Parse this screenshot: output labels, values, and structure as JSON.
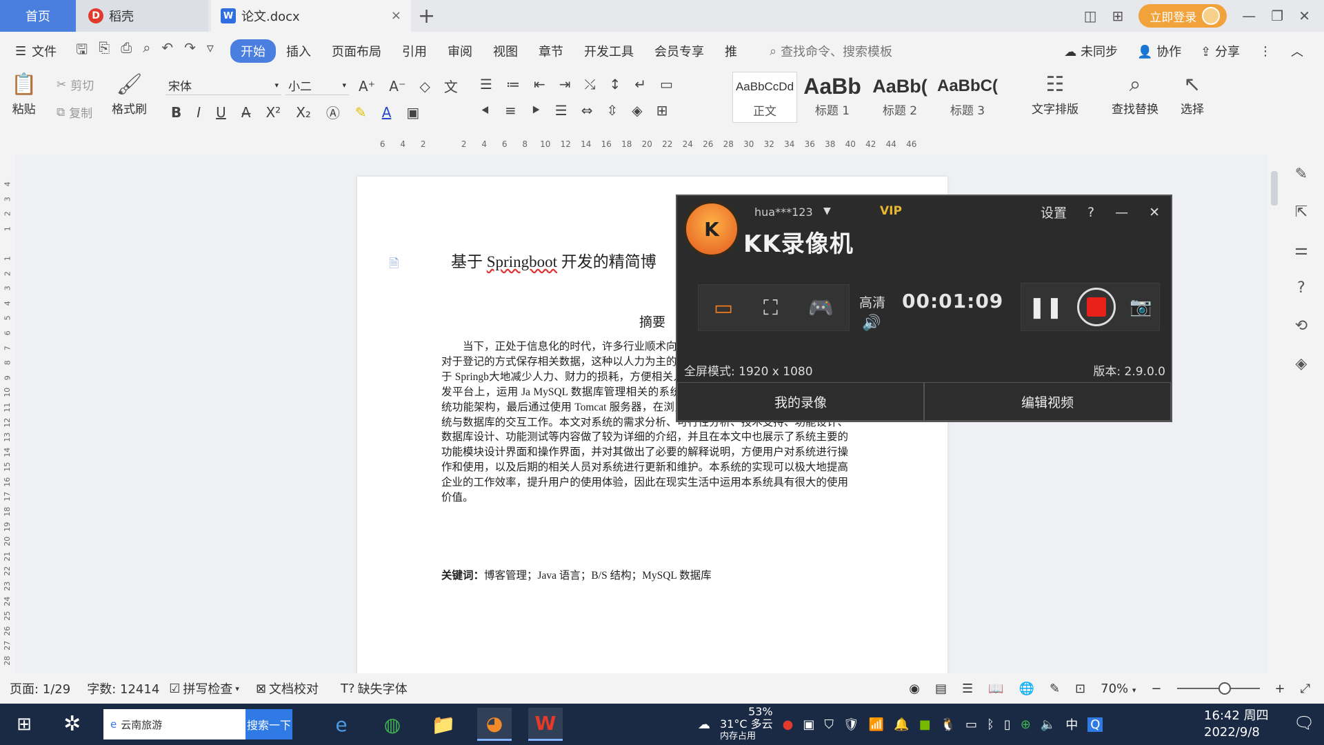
{
  "titlebar": {
    "tabs": [
      {
        "label": "首页"
      },
      {
        "label": "稻壳"
      },
      {
        "label": "论文.docx"
      }
    ],
    "login": "立即登录"
  },
  "menu": {
    "file": "文件",
    "tabs": [
      "开始",
      "插入",
      "页面布局",
      "引用",
      "审阅",
      "视图",
      "章节",
      "开发工具",
      "会员专享",
      "推"
    ],
    "search_placeholder": "查找命令、搜索模板",
    "sync": "未同步",
    "collab": "协作",
    "share": "分享"
  },
  "ribbon": {
    "paste": "粘贴",
    "cut": "剪切",
    "copy": "复制",
    "format_painter": "格式刷",
    "font_name": "宋体",
    "font_size": "小二",
    "styles": [
      {
        "sample": "AaBbCcDd",
        "name": "正文"
      },
      {
        "sample": "AaBb",
        "name": "标题 1"
      },
      {
        "sample": "AaBb(",
        "name": "标题 2"
      },
      {
        "sample": "AaBbC(",
        "name": "标题 3"
      }
    ],
    "text_layout": "文字排版",
    "find_replace": "查找替换",
    "select": "选择"
  },
  "ruler": {
    "marks": [
      "6",
      "4",
      "2",
      "",
      "2",
      "4",
      "6",
      "8",
      "10",
      "12",
      "14",
      "16",
      "18",
      "20",
      "22",
      "24",
      "26",
      "28",
      "30",
      "32",
      "34",
      "36",
      "38",
      "40",
      "42",
      "44",
      "46"
    ],
    "vmarks": [
      "4",
      "3",
      "2",
      "1",
      "",
      "1",
      "2",
      "3",
      "4",
      "5",
      "6",
      "7",
      "8",
      "9",
      "10",
      "11",
      "12",
      "13",
      "14",
      "15",
      "16",
      "17",
      "18",
      "19",
      "20",
      "21",
      "22",
      "23",
      "24",
      "25",
      "26",
      "27",
      "28"
    ]
  },
  "document": {
    "title_pre": "基于 ",
    "title_spell": "Springboot",
    "title_post": " 开发的精简博",
    "heading": "摘要",
    "abstract": "当下，正处于信息化的时代，许多行业顺术向数字化、信息化建设迈进。以前企业对于登记的方式保存相关数据，这种以人力为主的主流的程序开发技术，设计了一款基于 Springb大地减少人力、财力的损耗，方便相关人员及时用 B/S 开发模式，在 idea 开发平台上，运用 Ja MySQL 数据库管理相关的系统数据信息，SSM 框架设计和开发系统功能架构，最后通过使用 Tomcat 服务器，在浏览器中发布设计的系统，并且完成系统与数据库的交互工作。本文对系统的需求分析、可行性分析、技术支持、功能设计、数据库设计、功能测试等内容做了较为详细的介绍，并且在本文中也展示了系统主要的功能模块设计界面和操作界面，并对其做出了必要的解释说明，方便用户对系统进行操作和使用，以及后期的相关人员对系统进行更新和维护。本系统的实现可以极大地提高企业的工作效率，提升用户的使用体验，因此在现实生活中运用本系统具有很大的使用价值。",
    "keywords_label": "关键词：",
    "keywords": "博客管理；Java 语言；B/S 结构；MySQL 数据库"
  },
  "kk": {
    "user": "hua***123",
    "vip": "VIP",
    "title": "KK录像机",
    "settings": "设置",
    "help": "?",
    "quality": "高清",
    "timer": "00:01:09",
    "mode_text": "全屏模式: 1920 x 1080",
    "version": "版本: 2.9.0.0",
    "my_recordings": "我的录像",
    "edit_video": "编辑视频"
  },
  "status": {
    "page": "页面: 1/29",
    "words": "字数: 12414",
    "spellcheck": "拼写检查",
    "proof": "文档校对",
    "missing_font": "缺失字体",
    "zoom": "70%"
  },
  "taskbar": {
    "search_text": "云南旅游",
    "search_btn": "搜索一下",
    "weather_temp": "31°C 多云",
    "mem_pct": "53%",
    "mem_label": "内存占用",
    "ime": "中",
    "time": "16:42 周四",
    "date": "2022/9/8"
  },
  "colors": {
    "accent": "#4a7fe0",
    "kk_bg": "#2b2b2b",
    "record_red": "#e8211b",
    "vip_gold": "#e8b630"
  }
}
